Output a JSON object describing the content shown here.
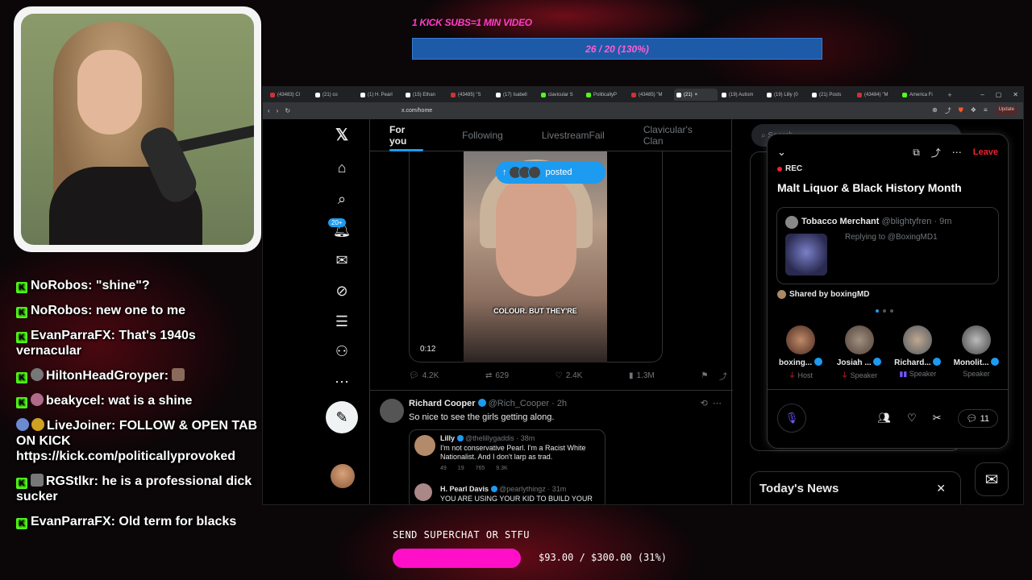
{
  "top_goal": {
    "label": "1 KICK SUBS=1 MIN VIDEO",
    "progress_text": "26 / 20 (130%)",
    "progress": 1.3
  },
  "chat": [
    {
      "user": "NoRobos",
      "text": "\"shine\"?",
      "badge": "kick"
    },
    {
      "user": "NoRobos",
      "text": "new one to me",
      "badge": "kick"
    },
    {
      "user": "EvanParraFX",
      "text": "That's 1940s vernacular",
      "badge": "kick"
    },
    {
      "user": "HiltonHeadGroyper",
      "text": "",
      "badge": "kick-emote"
    },
    {
      "user": "beakycel",
      "text": "wat is a shine",
      "badge": "kick-emote"
    },
    {
      "user": "LiveJoiner",
      "text": "FOLLOW & OPEN TAB ON KICK https://kick.com/politicallyprovoked",
      "badge": "emotes"
    },
    {
      "user": "RGStlkr",
      "text": "he is a professional dick sucker",
      "badge": "kick-emote"
    },
    {
      "user": "EvanParraFX",
      "text": "Old term for blacks",
      "badge": "kick"
    }
  ],
  "browser": {
    "tabs": [
      "(43483) Cl",
      "(21) co",
      "(1) H. Pearl",
      "(15) Ethan",
      "(43485) \"S",
      "(17) Isabell",
      "clavicular S",
      "PoliticallyP",
      "(43485) \"M",
      "(21)",
      "(19) Autism",
      "(19) Lilly (0",
      "(21) Posts",
      "(43484) \"M",
      "America Fi"
    ],
    "active_tab_index": 9,
    "url": "x.com/home",
    "update_label": "Update"
  },
  "feed": {
    "tabs": [
      "For you",
      "Following",
      "LivestreamFail",
      "Clavicular's Clan"
    ],
    "active_tab": 0,
    "posted_pill": "posted",
    "video_caption": "COLOUR. BUT THEY'RE",
    "video_time": "0:12",
    "actions": {
      "replies": "4.2K",
      "reposts": "629",
      "likes": "2.4K",
      "views": "1.3M"
    },
    "post2": {
      "name": "Richard Cooper",
      "handle": "@Rich_Cooper",
      "time": "2h",
      "text": "So nice to see the girls getting along.",
      "quote": {
        "name": "Lilly",
        "handle": "@thelillygaddis",
        "time": "38m",
        "text1": "I'm not conservative Pearl. I'm a Racist White",
        "text2": "Nationalist. And I don't larp as trad.",
        "replies": "49",
        "reposts": "19",
        "likes": "765",
        "views": "9.3K"
      },
      "quote2": {
        "name": "H. Pearl Davis",
        "handle": "@pearlythingz",
        "time": "31m",
        "text": "YOU ARE USING YOUR KID TO BUILD YOUR"
      }
    },
    "notif_badge": "20+"
  },
  "right": {
    "search_placeholder": "Search",
    "news_title": "Today's News"
  },
  "space": {
    "rec": "REC",
    "leave": "Leave",
    "title": "Malt Liquor & Black History Month",
    "pinned": {
      "name": "Tobacco Merchant",
      "handle": "@blightyfren",
      "time": "9m",
      "reply": "Replying to @BoxingMD1"
    },
    "shared_by": "Shared by boxingMD",
    "speakers": [
      {
        "name": "boxing...",
        "role": "Host"
      },
      {
        "name": "Josiah ...",
        "role": "Speaker"
      },
      {
        "name": "Richard...",
        "role": "Speaker"
      },
      {
        "name": "Monolit...",
        "role": "Speaker"
      }
    ],
    "reply_count": "11"
  },
  "superchat": {
    "label": "SEND SUPERCHAT OR STFU",
    "amount_text": "$93.00 / $300.00 (31%)",
    "progress": 0.31
  }
}
